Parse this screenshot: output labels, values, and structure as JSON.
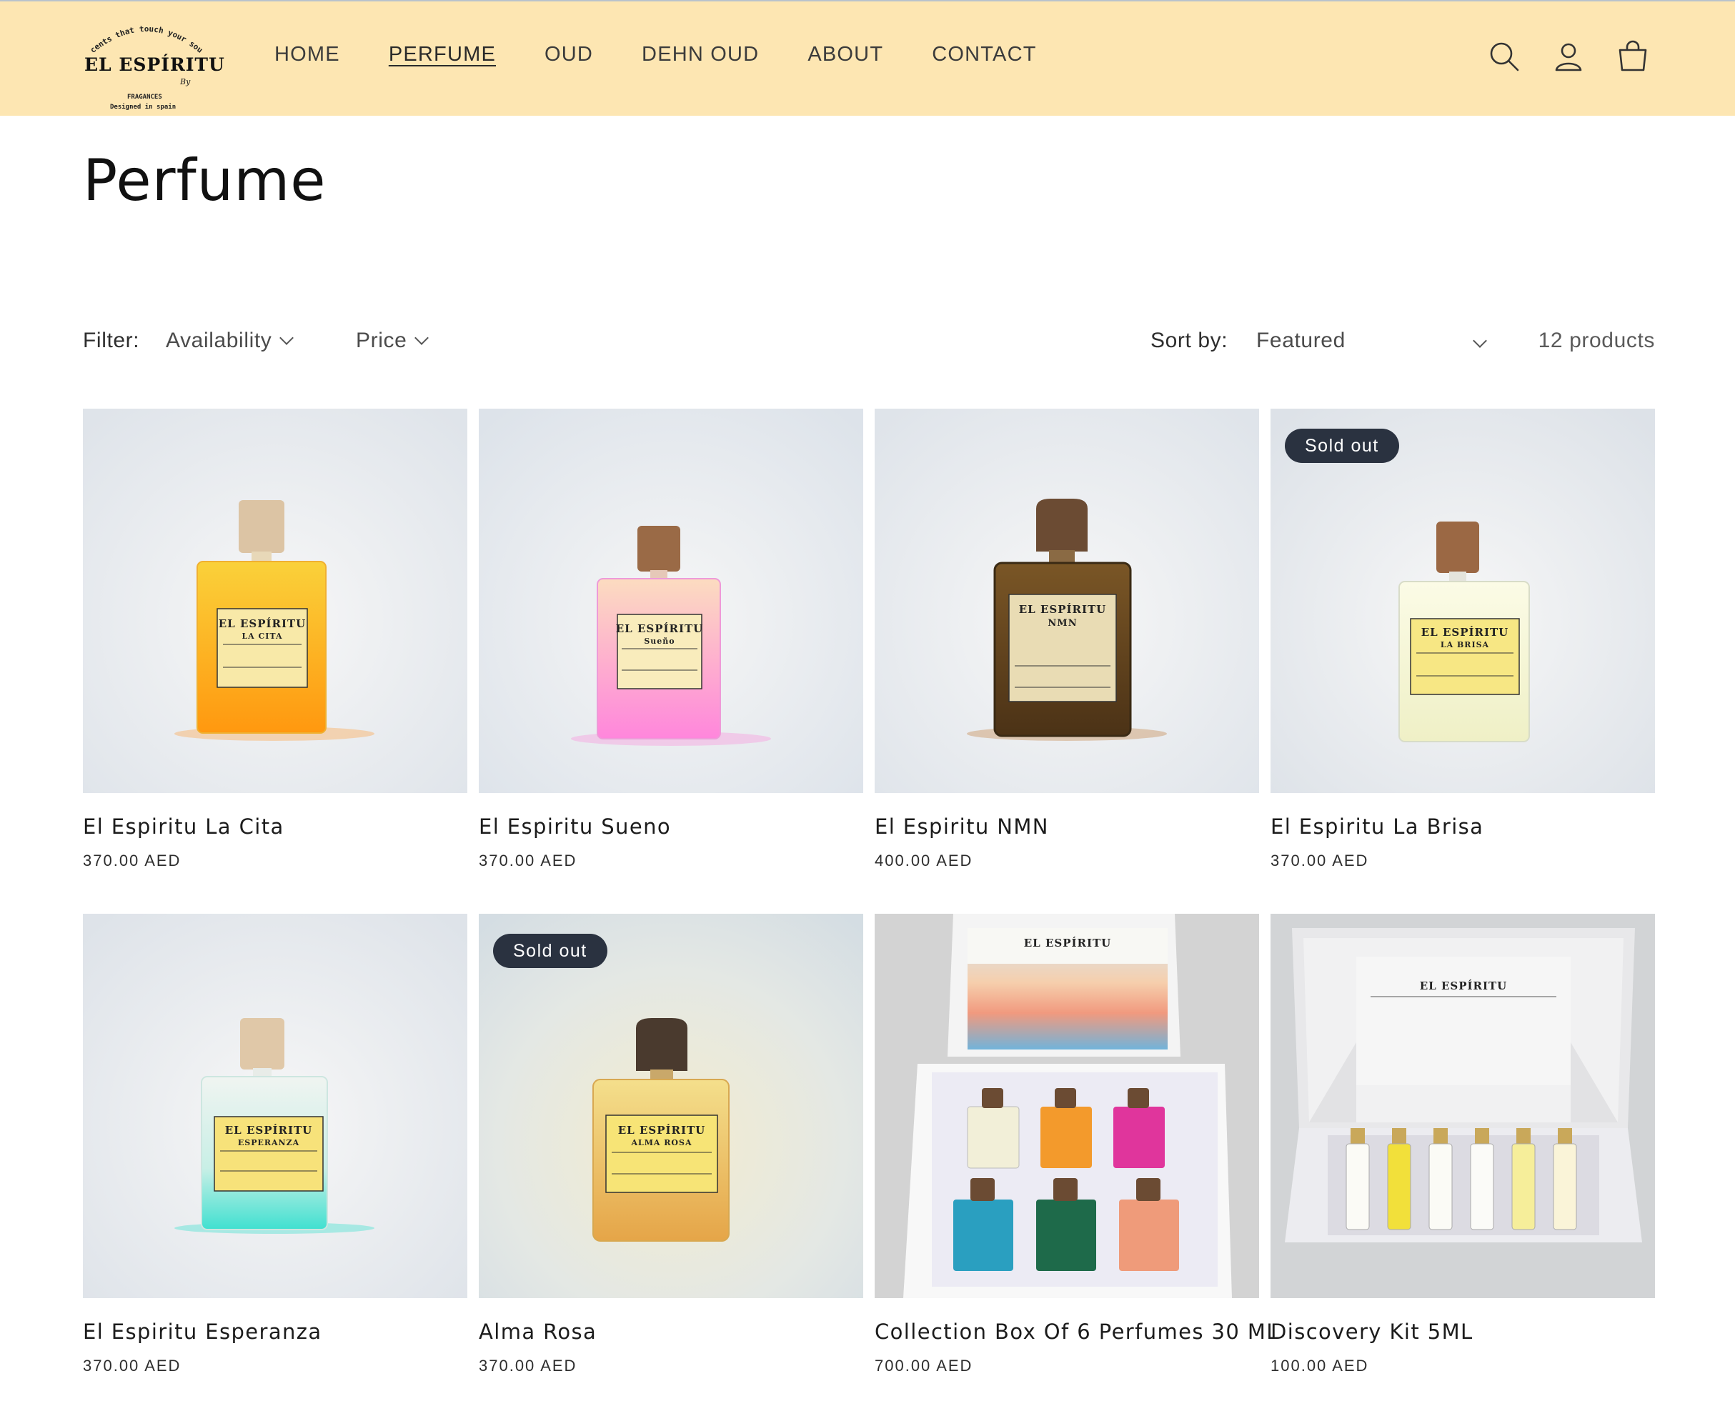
{
  "header": {
    "logo": {
      "tagline": "Scents that touch your soul",
      "brand": "EL ESPÍRITU",
      "by": "By",
      "line1": "FRAGANCES",
      "line2": "Designed in spain"
    },
    "nav": [
      {
        "label": "HOME",
        "active": false
      },
      {
        "label": "PERFUME",
        "active": true
      },
      {
        "label": "OUD",
        "active": false
      },
      {
        "label": "DEHN OUD",
        "active": false
      },
      {
        "label": "ABOUT",
        "active": false
      },
      {
        "label": "CONTACT",
        "active": false
      }
    ],
    "icons": [
      "search-icon",
      "account-icon",
      "cart-icon"
    ]
  },
  "page": {
    "title": "Perfume"
  },
  "filters": {
    "label": "Filter:",
    "availability": "Availability",
    "price": "Price",
    "sort_label": "Sort by:",
    "sort_value": "Featured",
    "count": "12 products"
  },
  "colors": {
    "header_bg": "#fde6b2",
    "badge_bg": "#2a3240"
  },
  "products": [
    {
      "name": "El Espiritu La Cita",
      "price": "370.00 AED",
      "badge": "",
      "label_title": "EL ESPÍRITU",
      "label_sub": "LA CITA",
      "liquid_top": "#f9c623",
      "liquid_bottom": "#ff9c10",
      "cap": "#dcc4a4"
    },
    {
      "name": "El Espiritu Sueno",
      "price": "370.00 AED",
      "badge": "",
      "label_title": "EL ESPÍRITU",
      "label_sub": "Sueño",
      "liquid_top": "#fcd8bf",
      "liquid_bottom": "#ff8bdc",
      "cap": "#9a6a46"
    },
    {
      "name": "El Espiritu NMN",
      "price": "400.00 AED",
      "badge": "",
      "label_title": "EL ESPÍRITU",
      "label_sub": "NMN",
      "liquid_top": "#6a4a22",
      "liquid_bottom": "#4c3418",
      "cap": "#6b4b33"
    },
    {
      "name": "El Espiritu La Brisa",
      "price": "370.00 AED",
      "badge": "Sold out",
      "label_title": "EL ESPÍRITU",
      "label_sub": "LA BRISA",
      "liquid_top": "#f7f6d6",
      "liquid_bottom": "#f0f0c8",
      "cap": "#9b6844"
    },
    {
      "name": "El Espiritu Esperanza",
      "price": "370.00 AED",
      "badge": "",
      "label_title": "EL ESPÍRITU",
      "label_sub": "ESPERANZA",
      "liquid_top": "#eef3ef",
      "liquid_bottom": "#4fe3d3",
      "cap": "#e0c8a8"
    },
    {
      "name": "Alma Rosa",
      "price": "370.00 AED",
      "badge": "Sold out",
      "label_title": "EL ESPÍRITU",
      "label_sub": "ALMA ROSA",
      "liquid_top": "#f3dc88",
      "liquid_bottom": "#e8a84a",
      "cap": "#4a3a2e"
    },
    {
      "name": "Collection Box Of 6 Perfumes 30 ML",
      "price": "700.00 AED",
      "badge": "",
      "label_title": "EL ESPÍRITU",
      "label_sub": "",
      "liquid_top": "",
      "liquid_bottom": "",
      "cap": ""
    },
    {
      "name": "Discovery Kit 5ML",
      "price": "100.00 AED",
      "badge": "",
      "label_title": "EL ESPÍRITU",
      "label_sub": "",
      "liquid_top": "",
      "liquid_bottom": "",
      "cap": ""
    }
  ]
}
